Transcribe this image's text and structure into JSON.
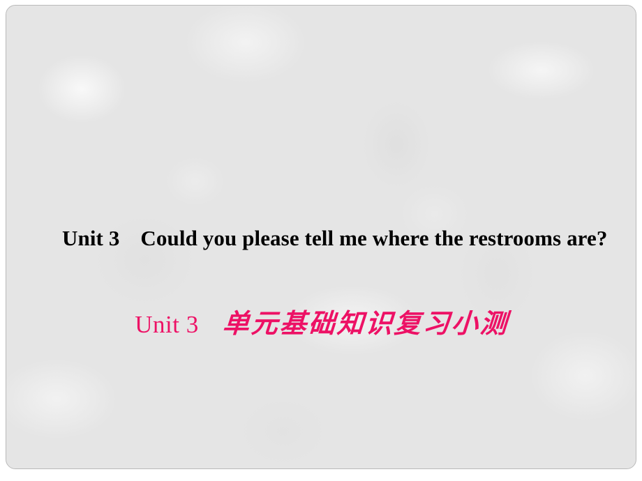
{
  "slide": {
    "background_color": "#e5e5e5",
    "border_color": "#b9b9b9",
    "accent_color": "#ed1165",
    "text_color": "#000000",
    "title": {
      "unit_label": "Unit 3",
      "question": "Could you please tell me where the restrooms are?",
      "full_text": "Unit 3　Could you please tell me where the restrooms are?"
    },
    "subtitle": {
      "unit_label": "Unit 3",
      "chinese_text": "单元基础知识复习小测",
      "full_text": "Unit 3　单元基础知识复习小测"
    }
  }
}
